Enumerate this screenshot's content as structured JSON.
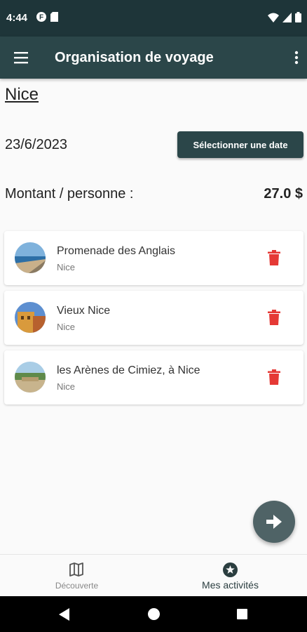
{
  "status_bar": {
    "time": "4:44"
  },
  "app_bar": {
    "title": "Organisation de voyage"
  },
  "trip": {
    "city": "Nice",
    "date": "23/6/2023",
    "date_button": "Sélectionner une date",
    "amount_label": "Montant / personne :",
    "amount_value": "27.0 $"
  },
  "activities": [
    {
      "name": "Promenade des Anglais",
      "city": "Nice",
      "icon": "beach-photo"
    },
    {
      "name": "Vieux Nice",
      "city": "Nice",
      "icon": "old-town-photo"
    },
    {
      "name": "les Arènes de Cimiez, à Nice",
      "city": "Nice",
      "icon": "arena-photo"
    }
  ],
  "bottom_nav": {
    "items": [
      {
        "label": "Découverte",
        "icon": "map-icon",
        "active": false
      },
      {
        "label": "Mes activités",
        "icon": "star-circle-icon",
        "active": true
      }
    ]
  },
  "colors": {
    "primary": "#2b4649",
    "status_bar": "#1e3539",
    "delete": "#e53935",
    "fab": "#4f6366"
  }
}
